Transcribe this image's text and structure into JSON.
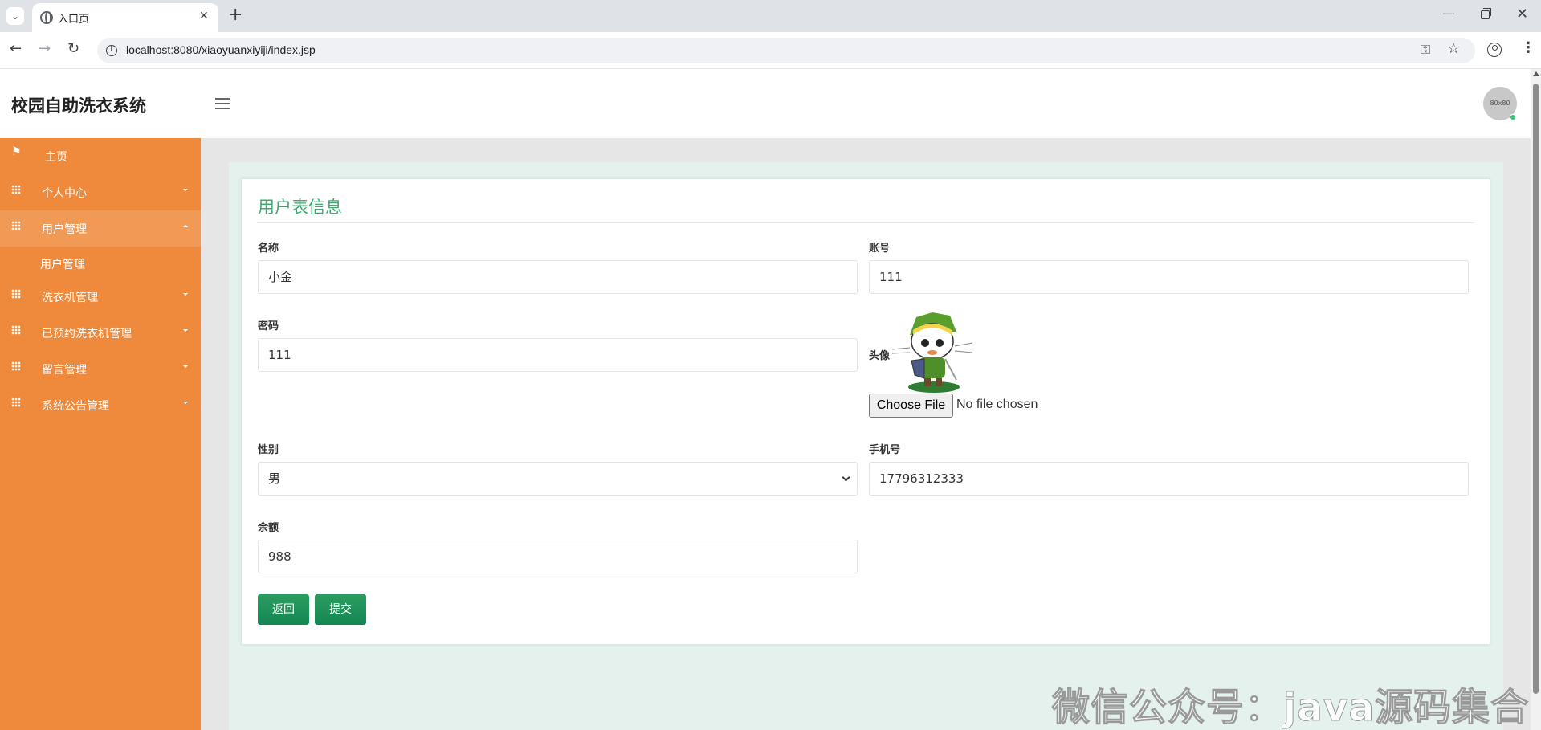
{
  "browser": {
    "tab_title": "入口页",
    "url": "localhost:8080/xiaoyuanxiyiji/index.jsp"
  },
  "header": {
    "app_title": "校园自助洗衣系统",
    "avatar_text": "80x80"
  },
  "sidebar": {
    "items": [
      {
        "label": "主页",
        "icon": "flag-icon"
      },
      {
        "label": "个人中心",
        "icon": "grid-icon"
      },
      {
        "label": "用户管理",
        "icon": "grid-icon",
        "expanded": true
      },
      {
        "label": "洗衣机管理",
        "icon": "grid-icon"
      },
      {
        "label": "已预约洗衣机管理",
        "icon": "grid-icon"
      },
      {
        "label": "留言管理",
        "icon": "grid-icon"
      },
      {
        "label": "系统公告管理",
        "icon": "grid-icon"
      }
    ],
    "submenu": {
      "label": "用户管理"
    }
  },
  "form": {
    "title": "用户表信息",
    "name": {
      "label": "名称",
      "value": "小金"
    },
    "account": {
      "label": "账号",
      "value": "111"
    },
    "password": {
      "label": "密码",
      "value": "111"
    },
    "avatar": {
      "label": "头像",
      "file_button": "Choose File",
      "file_status": "No file chosen"
    },
    "gender": {
      "label": "性别",
      "value": "男"
    },
    "phone": {
      "label": "手机号",
      "value": "17796312333"
    },
    "balance": {
      "label": "余额",
      "value": "988"
    },
    "buttons": {
      "back": "返回",
      "submit": "提交"
    }
  },
  "watermark": "微信公众号：java源码集合",
  "colors": {
    "sidebar": "#ef8a3c",
    "accent_green": "#3eaa6f",
    "button_green": "#138654",
    "content_bg": "#e4f1ec"
  }
}
